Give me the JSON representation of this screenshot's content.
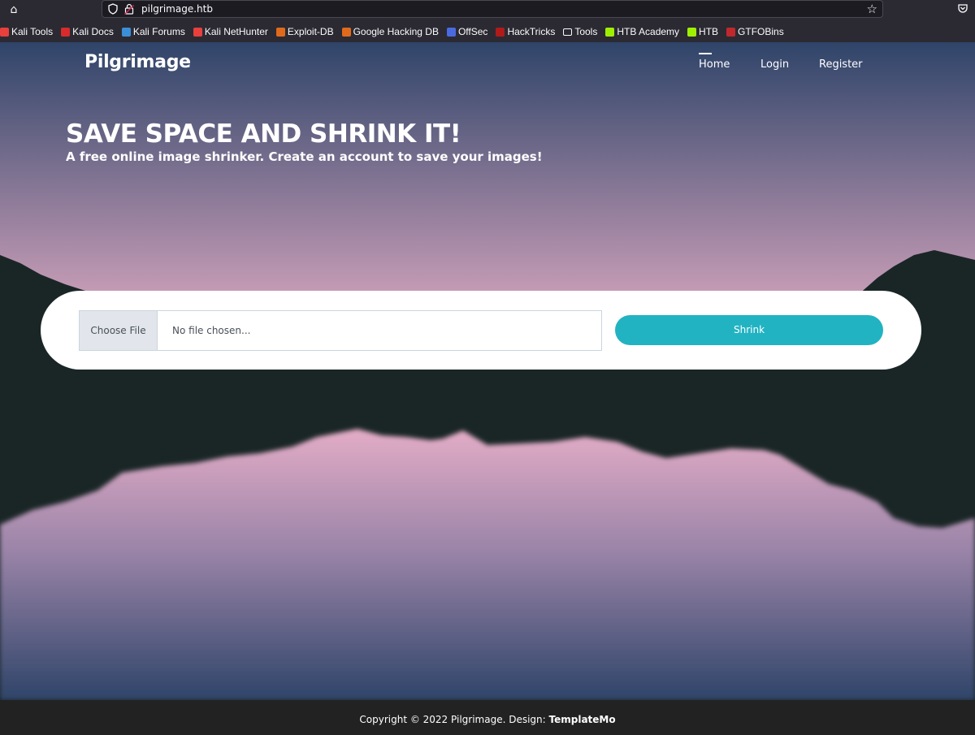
{
  "browser": {
    "url": "pilgrimage.htb",
    "bookmarks": [
      {
        "label": "Kali Tools",
        "icon": "kali-dragon-icon",
        "color": "#e8403c"
      },
      {
        "label": "Kali Docs",
        "icon": "kali-docs-icon",
        "color": "#d82b2b"
      },
      {
        "label": "Kali Forums",
        "icon": "kali-forums-icon",
        "color": "#3b8fd8"
      },
      {
        "label": "Kali NetHunter",
        "icon": "kali-nethunter-icon",
        "color": "#e8403c"
      },
      {
        "label": "Exploit-DB",
        "icon": "exploit-db-icon",
        "color": "#e06a1c"
      },
      {
        "label": "Google Hacking DB",
        "icon": "ghdb-icon",
        "color": "#e06a1c"
      },
      {
        "label": "OffSec",
        "icon": "offsec-icon",
        "color": "#4a6ae0"
      },
      {
        "label": "HackTricks",
        "icon": "hacktricks-icon",
        "color": "#b01a1a"
      },
      {
        "label": "Tools",
        "icon": "folder-icon",
        "color": "#fbfbfe"
      },
      {
        "label": "HTB Academy",
        "icon": "htb-academy-icon",
        "color": "#9fef00"
      },
      {
        "label": "HTB",
        "icon": "htb-icon",
        "color": "#9fef00"
      },
      {
        "label": "GTFOBins",
        "icon": "gtfobins-icon",
        "color": "#c0282b"
      }
    ]
  },
  "site": {
    "brand": "Pilgrimage",
    "nav": {
      "home": "Home",
      "login": "Login",
      "register": "Register"
    },
    "hero": {
      "title": "SAVE SPACE AND SHRINK IT!",
      "subtitle": "A free online image shrinker. Create an account to save your images!"
    },
    "upload": {
      "choose_file": "Choose File",
      "file_status": "No file chosen...",
      "submit": "Shrink"
    },
    "footer": {
      "text": "Copyright © 2022 Pilgrimage. Design: ",
      "link": "TemplateMo"
    }
  },
  "colors": {
    "accent": "#22b3c2",
    "sky_top": "#2f4469",
    "sky_mid": "#c49bb5",
    "mountain": "#1a2626"
  }
}
